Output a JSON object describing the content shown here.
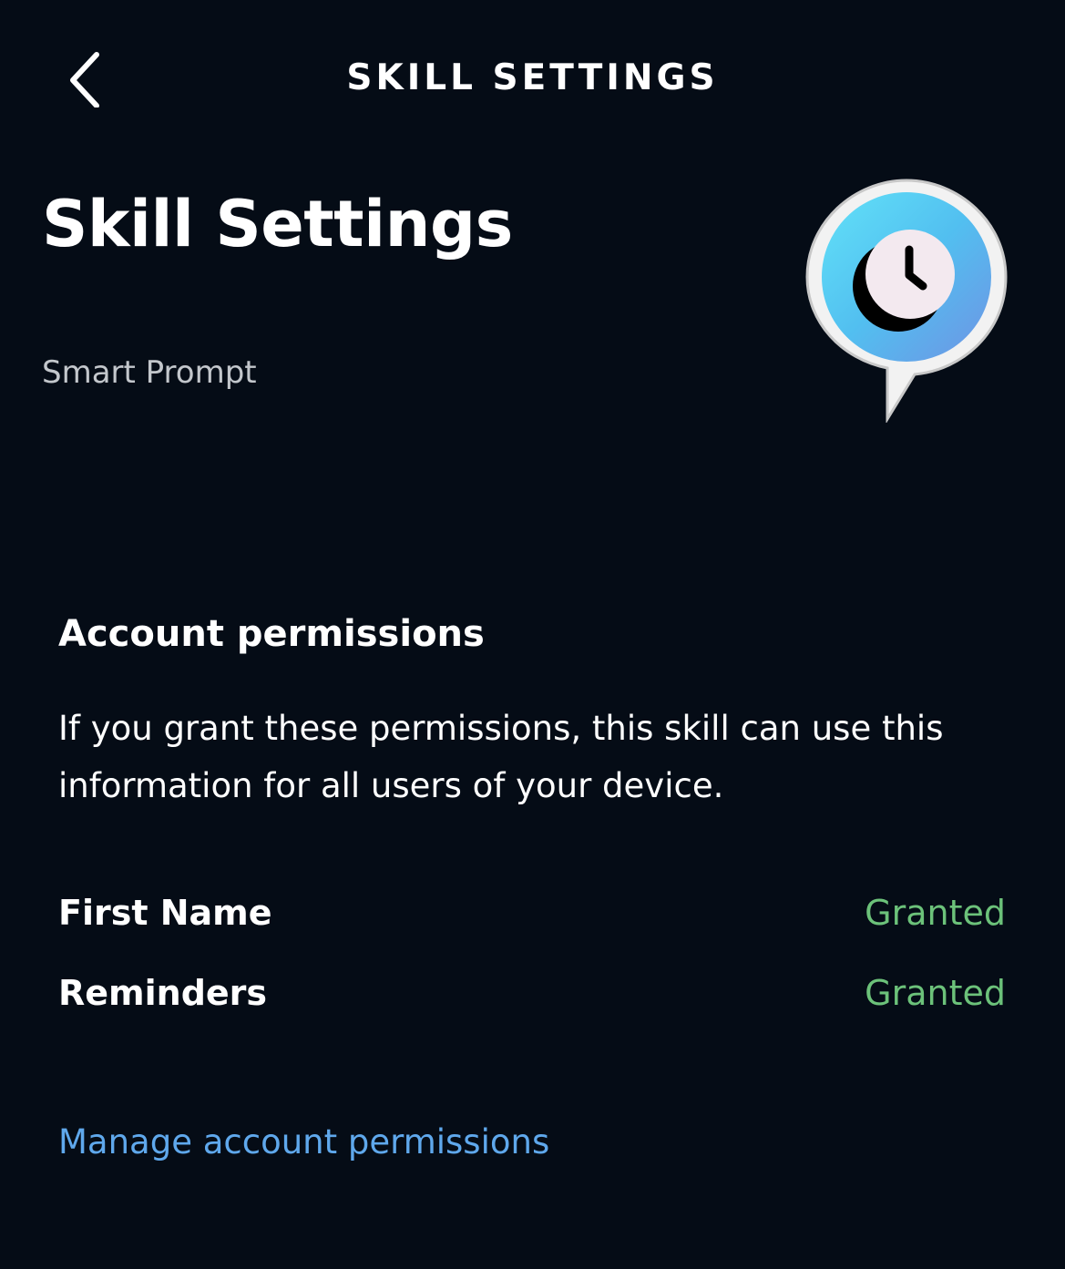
{
  "header": {
    "back_icon": "chevron-left-icon",
    "title": "SKILL SETTINGS"
  },
  "skill": {
    "page_title": "Skill Settings",
    "name": "Smart Prompt",
    "logo_icon": "clock-speech-bubble-icon"
  },
  "permissions": {
    "heading": "Account permissions",
    "description": "If you grant these permissions, this skill can use this information for all users of your device.",
    "items": [
      {
        "label": "First Name",
        "status": "Granted"
      },
      {
        "label": "Reminders",
        "status": "Granted"
      }
    ],
    "manage_link": "Manage account permissions"
  },
  "colors": {
    "background": "#050c16",
    "granted": "#6cc27a",
    "link": "#5fa8ec",
    "subtitle": "#c3c7cc"
  }
}
